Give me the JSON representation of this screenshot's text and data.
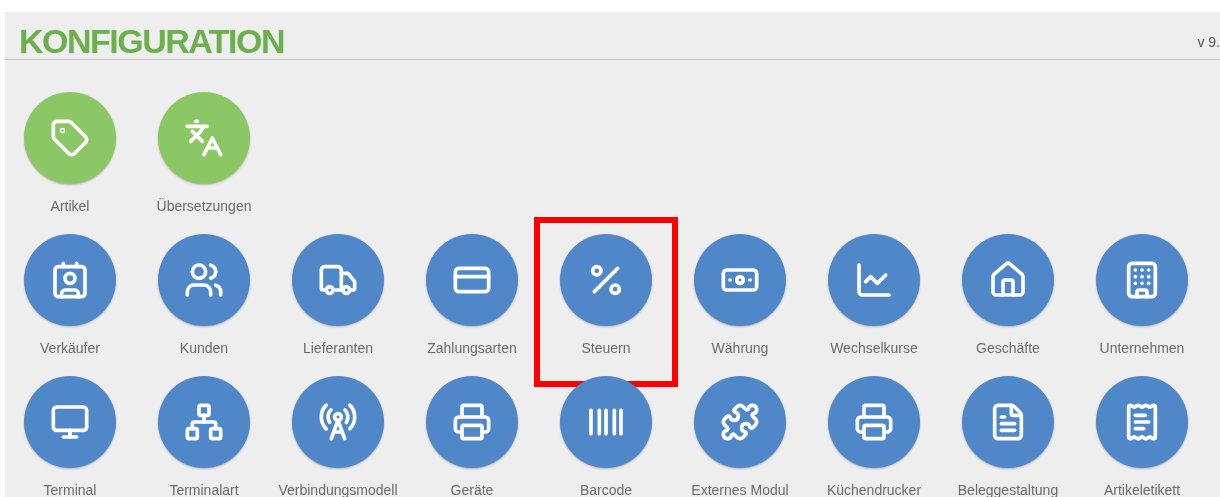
{
  "header": {
    "title": "KONFIGURATION",
    "version": "v 9."
  },
  "sections": [
    {
      "items": [
        {
          "label": "Artikel",
          "color": "#8cc766",
          "highlighted": false
        },
        {
          "label": "Übersetzungen",
          "color": "#8cc766",
          "highlighted": false
        }
      ]
    },
    {
      "items": [
        {
          "label": "Verkäufer",
          "color": "#4f87c8",
          "highlighted": false
        },
        {
          "label": "Kunden",
          "color": "#4f87c8",
          "highlighted": false
        },
        {
          "label": "Lieferanten",
          "color": "#4f87c8",
          "highlighted": false
        },
        {
          "label": "Zahlungsarten",
          "color": "#4f87c8",
          "highlighted": false
        },
        {
          "label": "Steuern",
          "color": "#4f87c8",
          "highlighted": true
        },
        {
          "label": "Währung",
          "color": "#4f87c8",
          "highlighted": false
        },
        {
          "label": "Wechselkurse",
          "color": "#4f87c8",
          "highlighted": false
        },
        {
          "label": "Geschäfte",
          "color": "#4f87c8",
          "highlighted": false
        },
        {
          "label": "Unternehmen",
          "color": "#4f87c8",
          "highlighted": false
        },
        {
          "label": "Terminal",
          "color": "#4f87c8",
          "highlighted": false
        },
        {
          "label": "Terminalart",
          "color": "#4f87c8",
          "highlighted": false
        },
        {
          "label": "Verbindungsmodell",
          "color": "#4f87c8",
          "highlighted": false
        },
        {
          "label": "Geräte",
          "color": "#4f87c8",
          "highlighted": false
        },
        {
          "label": "Barcode",
          "color": "#4f87c8",
          "highlighted": false
        },
        {
          "label": "Externes Modul",
          "color": "#4f87c8",
          "highlighted": false
        },
        {
          "label": "Küchendrucker",
          "color": "#4f87c8",
          "highlighted": false
        },
        {
          "label": "Beleggestaltung",
          "color": "#4f87c8",
          "highlighted": false
        },
        {
          "label": "Artikeletikett",
          "color": "#4f87c8",
          "highlighted": false
        }
      ]
    }
  ]
}
